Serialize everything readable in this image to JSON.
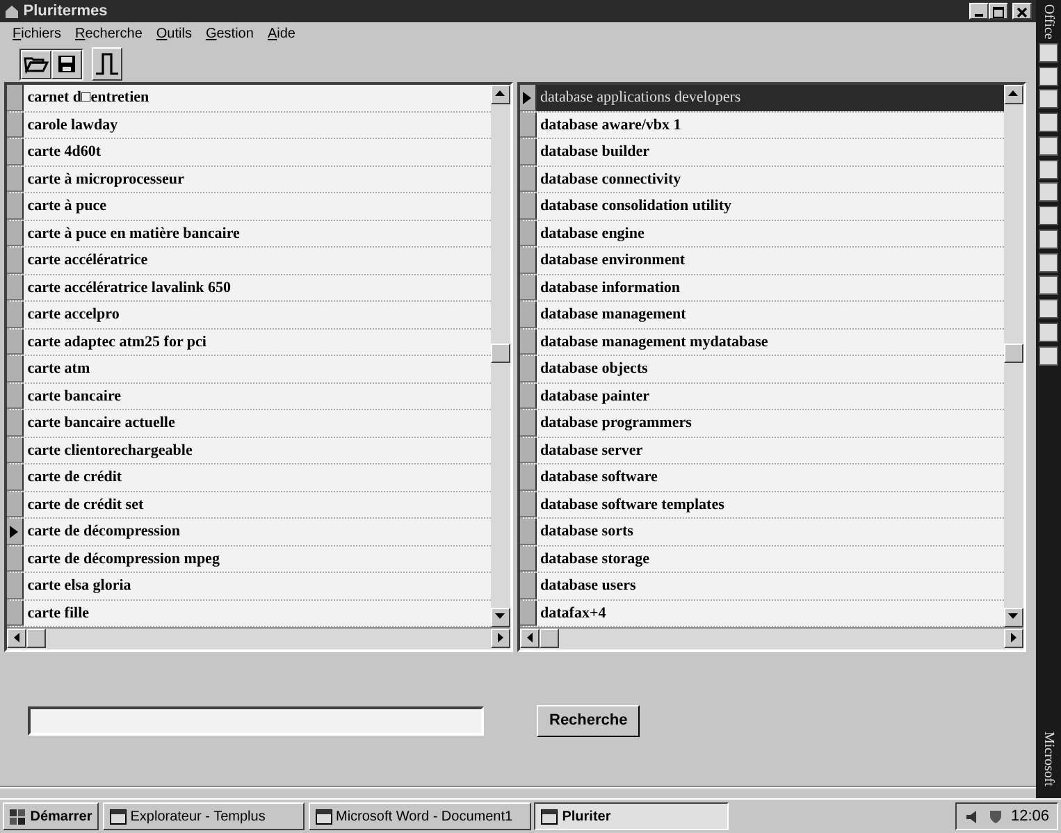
{
  "window": {
    "title": "Pluritermes"
  },
  "menu": [
    {
      "label": "Fichiers"
    },
    {
      "label": "Recherche"
    },
    {
      "label": "Outils"
    },
    {
      "label": "Gestion"
    },
    {
      "label": "Aide"
    }
  ],
  "lists": [
    {
      "rows": [
        {
          "text": "carnet d□entretien",
          "current": false,
          "selected": false
        },
        {
          "text": "carole lawday",
          "current": false,
          "selected": false
        },
        {
          "text": "carte 4d60t",
          "current": false,
          "selected": false
        },
        {
          "text": "carte à microprocesseur",
          "current": false,
          "selected": false
        },
        {
          "text": "carte à puce",
          "current": false,
          "selected": false
        },
        {
          "text": "carte à puce en matière bancaire",
          "current": false,
          "selected": false
        },
        {
          "text": "carte accélératrice",
          "current": false,
          "selected": false
        },
        {
          "text": "carte accélératrice lavalink 650",
          "current": false,
          "selected": false
        },
        {
          "text": "carte accelpro",
          "current": false,
          "selected": false
        },
        {
          "text": "carte adaptec atm25 for pci",
          "current": false,
          "selected": false
        },
        {
          "text": "carte atm",
          "current": false,
          "selected": false
        },
        {
          "text": "carte bancaire",
          "current": false,
          "selected": false
        },
        {
          "text": "carte bancaire actuelle",
          "current": false,
          "selected": false
        },
        {
          "text": "carte clientorechargeable",
          "current": false,
          "selected": false
        },
        {
          "text": "carte de crédit",
          "current": false,
          "selected": false
        },
        {
          "text": "carte de crédit set",
          "current": false,
          "selected": false
        },
        {
          "text": "carte de décompression",
          "current": true,
          "selected": false
        },
        {
          "text": "carte de décompression mpeg",
          "current": false,
          "selected": false
        },
        {
          "text": "carte elsa gloria",
          "current": false,
          "selected": false
        },
        {
          "text": "carte fille",
          "current": false,
          "selected": false
        }
      ]
    },
    {
      "rows": [
        {
          "text": "database applications developers",
          "current": true,
          "selected": true
        },
        {
          "text": "database aware/vbx 1",
          "current": false,
          "selected": false
        },
        {
          "text": "database builder",
          "current": false,
          "selected": false
        },
        {
          "text": "database connectivity",
          "current": false,
          "selected": false
        },
        {
          "text": "database consolidation utility",
          "current": false,
          "selected": false
        },
        {
          "text": "database engine",
          "current": false,
          "selected": false
        },
        {
          "text": "database environment",
          "current": false,
          "selected": false
        },
        {
          "text": "database information",
          "current": false,
          "selected": false
        },
        {
          "text": "database management",
          "current": false,
          "selected": false
        },
        {
          "text": "database management mydatabase",
          "current": false,
          "selected": false
        },
        {
          "text": "database objects",
          "current": false,
          "selected": false
        },
        {
          "text": "database painter",
          "current": false,
          "selected": false
        },
        {
          "text": "database programmers",
          "current": false,
          "selected": false
        },
        {
          "text": "database server",
          "current": false,
          "selected": false
        },
        {
          "text": "database software",
          "current": false,
          "selected": false
        },
        {
          "text": "database software templates",
          "current": false,
          "selected": false
        },
        {
          "text": "database sorts",
          "current": false,
          "selected": false
        },
        {
          "text": "database storage",
          "current": false,
          "selected": false
        },
        {
          "text": "database users",
          "current": false,
          "selected": false
        },
        {
          "text": "datafax+4",
          "current": false,
          "selected": false
        }
      ]
    }
  ],
  "search": {
    "button": "Recherche"
  },
  "office_bar": {
    "top_label": "Office",
    "bottom_label": "Microsoft"
  },
  "taskbar": {
    "start": "Démarrer",
    "tasks": [
      {
        "label": "Explorateur - Templus",
        "selected": false
      },
      {
        "label": "Microsoft Word - Document1",
        "selected": false
      },
      {
        "label": "Pluriter",
        "selected": true
      }
    ],
    "clock": "12:06"
  }
}
